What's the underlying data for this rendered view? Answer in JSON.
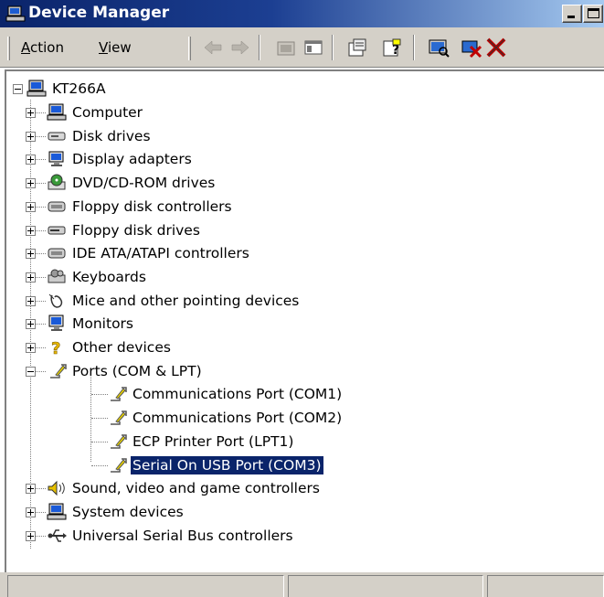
{
  "window": {
    "title": "Device Manager"
  },
  "toolbar": {
    "menus": [
      {
        "label": "Action",
        "accel": "A",
        "rest": "ction"
      },
      {
        "label": "View",
        "accel": "V",
        "rest": "iew"
      }
    ],
    "icons": [
      "back-arrow-icon",
      "forward-arrow-icon",
      "up-folder-icon",
      "show-hide-tree-icon",
      "properties-icon",
      "help-icon",
      "scan-hardware-icon",
      "disable-device-icon",
      "uninstall-device-icon"
    ]
  },
  "tree": {
    "root": "KT266A",
    "categories": [
      {
        "label": "Computer",
        "icon": "computer-icon",
        "expanded": false
      },
      {
        "label": "Disk drives",
        "icon": "disk-drive-icon",
        "expanded": false
      },
      {
        "label": "Display adapters",
        "icon": "display-adapter-icon",
        "expanded": false
      },
      {
        "label": "DVD/CD-ROM drives",
        "icon": "cd-drive-icon",
        "expanded": false
      },
      {
        "label": "Floppy disk controllers",
        "icon": "controller-icon",
        "expanded": false
      },
      {
        "label": "Floppy disk drives",
        "icon": "floppy-drive-icon",
        "expanded": false
      },
      {
        "label": "IDE ATA/ATAPI controllers",
        "icon": "controller-icon",
        "expanded": false
      },
      {
        "label": "Keyboards",
        "icon": "keyboard-icon",
        "expanded": false
      },
      {
        "label": "Mice and other pointing devices",
        "icon": "mouse-icon",
        "expanded": false
      },
      {
        "label": "Monitors",
        "icon": "monitor-icon",
        "expanded": false
      },
      {
        "label": "Other devices",
        "icon": "question-mark-icon",
        "expanded": false
      },
      {
        "label": "Ports (COM & LPT)",
        "icon": "port-connector-icon",
        "expanded": true,
        "children": [
          {
            "label": "Communications Port (COM1)",
            "icon": "port-connector-icon",
            "selected": false
          },
          {
            "label": "Communications Port (COM2)",
            "icon": "port-connector-icon",
            "selected": false
          },
          {
            "label": "ECP Printer Port (LPT1)",
            "icon": "port-connector-icon",
            "selected": false
          },
          {
            "label": "Serial On USB Port (COM3)",
            "icon": "port-connector-icon",
            "selected": true
          }
        ]
      },
      {
        "label": "Sound, video and game controllers",
        "icon": "speaker-icon",
        "expanded": false
      },
      {
        "label": "System devices",
        "icon": "computer-icon",
        "expanded": false
      },
      {
        "label": "Universal Serial Bus controllers",
        "icon": "usb-icon",
        "expanded": false
      }
    ]
  },
  "colors": {
    "titlebar_start": "#0a246a",
    "titlebar_end": "#a6caf0",
    "selection": "#0a246a",
    "chrome": "#d4d0c8"
  }
}
